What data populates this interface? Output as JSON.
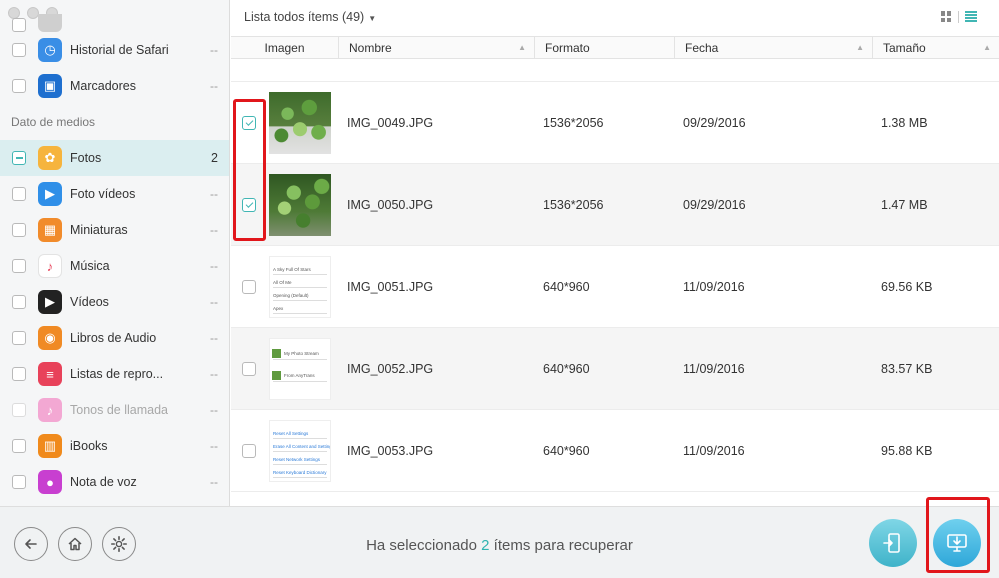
{
  "sidebar": {
    "items": [
      {
        "name": "sidebar-item-partial",
        "label": "",
        "count": "",
        "icon": "blank-icon",
        "color": "#cfcfcf",
        "checked": "none"
      },
      {
        "name": "sidebar-item-safari-history",
        "label": "Historial de Safari",
        "count": "--",
        "icon": "clock-icon",
        "color": "#3a8ee6",
        "checked": "none"
      },
      {
        "name": "sidebar-item-bookmarks",
        "label": "Marcadores",
        "count": "--",
        "icon": "bookmark-icon",
        "color": "#1e6fcf",
        "checked": "none"
      }
    ],
    "section_title": "Dato de medios",
    "media_items": [
      {
        "name": "sidebar-item-photos",
        "label": "Fotos",
        "count": "2",
        "icon": "photos-icon",
        "color": "#f6b43d",
        "checked": "partial",
        "active": true
      },
      {
        "name": "sidebar-item-photo-videos",
        "label": "Foto vídeos",
        "count": "--",
        "icon": "photo-video-icon",
        "color": "#2f8fe8",
        "checked": "none"
      },
      {
        "name": "sidebar-item-thumbnails",
        "label": "Miniaturas",
        "count": "--",
        "icon": "thumbnail-icon",
        "color": "#f18b2b",
        "checked": "none"
      },
      {
        "name": "sidebar-item-music",
        "label": "Música",
        "count": "--",
        "icon": "music-icon",
        "color": "#ffffff",
        "checked": "none"
      },
      {
        "name": "sidebar-item-videos",
        "label": "Vídeos",
        "count": "--",
        "icon": "clapper-icon",
        "color": "#222222",
        "checked": "none"
      },
      {
        "name": "sidebar-item-audiobooks",
        "label": "Libros de Audio",
        "count": "--",
        "icon": "audiobook-icon",
        "color": "#f08a24",
        "checked": "none"
      },
      {
        "name": "sidebar-item-playlists",
        "label": "Listas de repro...",
        "count": "--",
        "icon": "playlist-icon",
        "color": "#e8425a",
        "checked": "none"
      },
      {
        "name": "sidebar-item-ringtones",
        "label": "Tonos de llamada",
        "count": "--",
        "icon": "bell-icon",
        "color": "#f3a8d3",
        "checked": "none",
        "disabled": true
      },
      {
        "name": "sidebar-item-ibooks",
        "label": "iBooks",
        "count": "--",
        "icon": "ibooks-icon",
        "color": "#f08a1c",
        "checked": "none"
      },
      {
        "name": "sidebar-item-voice-memo",
        "label": "Nota de voz",
        "count": "--",
        "icon": "microphone-icon",
        "color": "#c83fd0",
        "checked": "none"
      }
    ]
  },
  "header": {
    "list_title": "Lista todos ítems (49)",
    "caret": "▼"
  },
  "columns": {
    "image": "Imagen",
    "name": "Nombre",
    "format": "Formato",
    "date": "Fecha",
    "size": "Tamaño",
    "sort_glyph": "▲"
  },
  "rows": [
    {
      "name": "IMG_0049.JPG",
      "format": "1536*2056",
      "date": "09/29/2016",
      "size": "1.38 MB",
      "checked": true,
      "thumb": "plant"
    },
    {
      "name": "IMG_0050.JPG",
      "format": "1536*2056",
      "date": "09/29/2016",
      "size": "1.47 MB",
      "checked": true,
      "thumb": "plant2"
    },
    {
      "name": "IMG_0051.JPG",
      "format": "640*960",
      "date": "11/09/2016",
      "size": "69.56 KB",
      "checked": false,
      "thumb": "settings"
    },
    {
      "name": "IMG_0052.JPG",
      "format": "640*960",
      "date": "11/09/2016",
      "size": "83.57 KB",
      "checked": false,
      "thumb": "stream"
    },
    {
      "name": "IMG_0053.JPG",
      "format": "640*960",
      "date": "11/09/2016",
      "size": "95.88 KB",
      "checked": false,
      "thumb": "reset"
    }
  ],
  "thumb_texts": {
    "settings": [
      "A Sky Full Of Stars",
      "All Of Me",
      "Opening (Default)",
      "Apex"
    ],
    "stream": [
      "My Photo Stream",
      "From AnyTrans"
    ],
    "reset": [
      "Reset All Settings",
      "Erase All Content and Settings",
      "Reset Network Settings",
      "Reset Keyboard Dictionary"
    ]
  },
  "bottom": {
    "status_prefix": "Ha seleccionado",
    "selected_count": "2",
    "status_suffix": "ítems para recuperar",
    "back_icon": "back-arrow-icon",
    "home_icon": "home-icon",
    "settings_icon": "gear-icon",
    "to_device_icon": "to-device-icon",
    "to_computer_icon": "to-computer-icon"
  },
  "colors": {
    "accent": "#41b6b4",
    "highlight": "#e1161b"
  }
}
